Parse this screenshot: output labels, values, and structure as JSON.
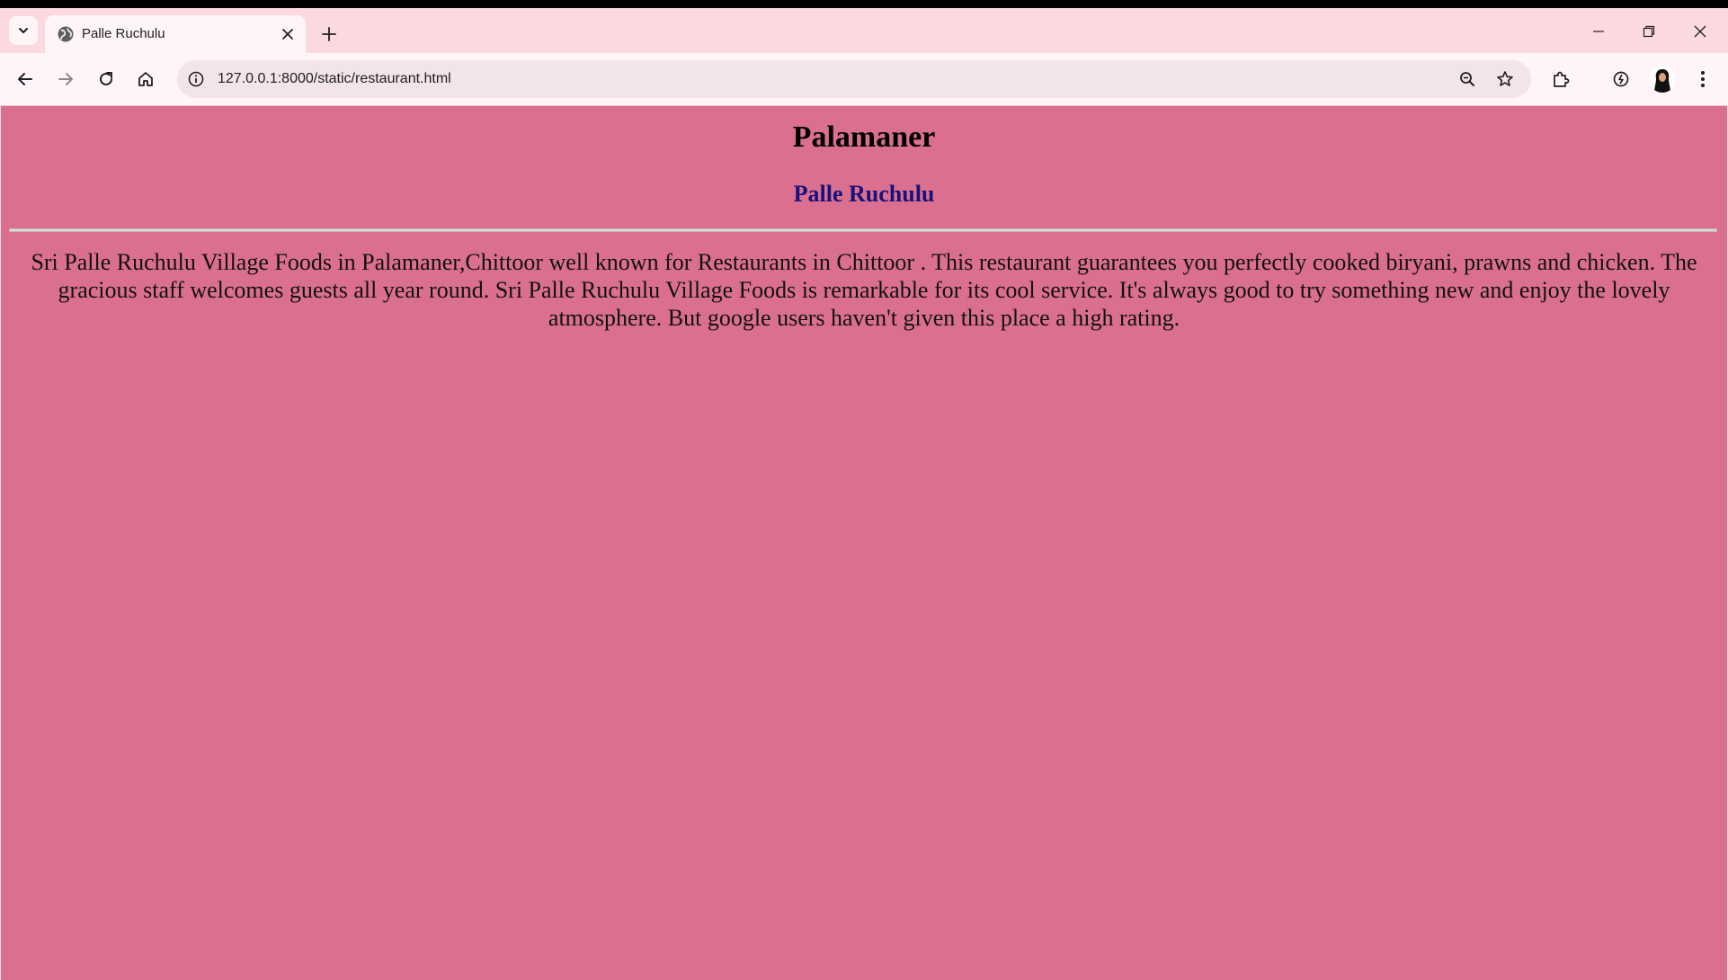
{
  "browser": {
    "tab": {
      "title": "Palle Ruchulu"
    },
    "address_bar": {
      "url": "127.0.0.1:8000/static/restaurant.html"
    },
    "icons": {
      "tab_search": "chevron-down-icon",
      "favicon": "globe-icon",
      "tab_close": "close-icon",
      "new_tab": "plus-icon",
      "minimize": "minimize-icon",
      "restore": "restore-icon",
      "close_window": "close-icon",
      "back": "back-arrow-icon",
      "forward": "forward-arrow-icon",
      "reload": "reload-icon",
      "home": "home-icon",
      "site_info": "info-icon",
      "zoom": "zoom-out-icon",
      "bookmark": "star-icon",
      "extensions": "puzzle-icon",
      "performance": "speedometer-icon",
      "menu": "kebab-menu-icon"
    }
  },
  "page": {
    "title": "Palamaner",
    "subtitle": "Palle Ruchulu",
    "description": "Sri Palle Ruchulu Village Foods in Palamaner,Chittoor well known for Restaurants in Chittoor . This restaurant guarantees you perfectly cooked biryani, prawns and chicken. The gracious staff welcomes guests all year round. Sri Palle Ruchulu Village Foods is remarkable for its cool service. It's always good to try something new and enjoy the lovely atmosphere. But google users haven't given this place a high rating.",
    "colors": {
      "background": "#db6f90",
      "subtitle": "#17127a"
    }
  }
}
